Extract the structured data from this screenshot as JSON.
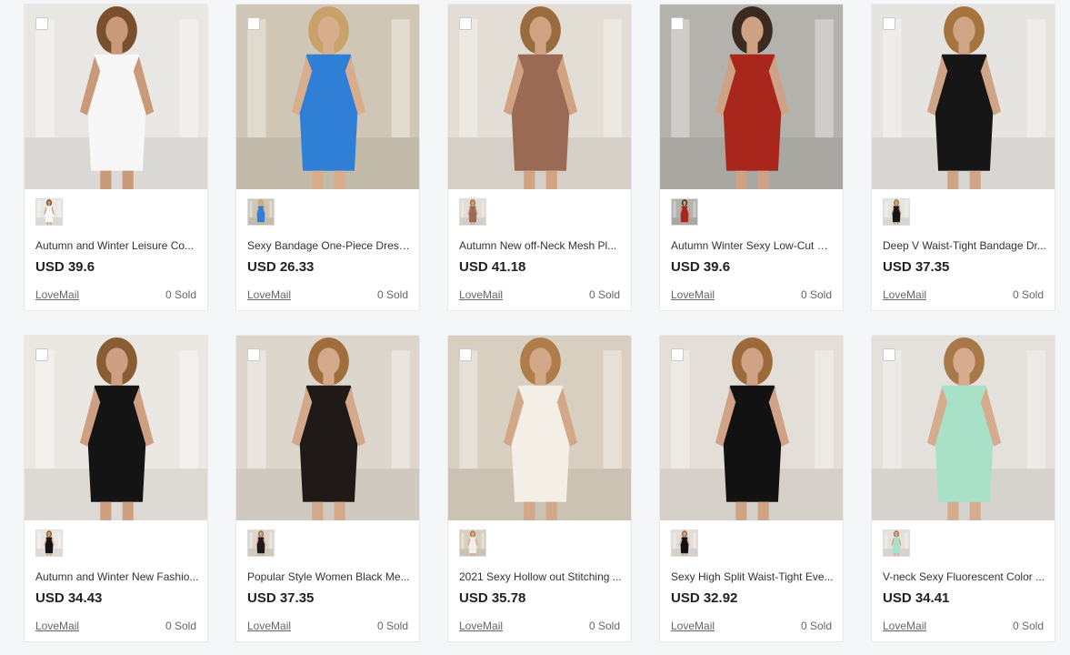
{
  "products": [
    {
      "title": "Autumn and Winter Leisure Co...",
      "price": "USD 39.6",
      "shop": "LoveMail",
      "sold": "0 Sold",
      "bg": "#e9e7e3",
      "dress": "#f7f7f7",
      "skin": "#c99a7a",
      "hair": "#7a4f2e"
    },
    {
      "title": "Sexy Bandage One-Piece Dress ...",
      "price": "USD 26.33",
      "shop": "LoveMail",
      "sold": "0 Sold",
      "bg": "#cfc6b6",
      "dress": "#2f7fd6",
      "skin": "#d8ad8c",
      "hair": "#c8a26a"
    },
    {
      "title": "Autumn New off-Neck Mesh Pl...",
      "price": "USD 41.18",
      "shop": "LoveMail",
      "sold": "0 Sold",
      "bg": "#e2ddd5",
      "dress": "#9a6a55",
      "skin": "#d2a383",
      "hair": "#9a6b3e"
    },
    {
      "title": "Autumn Winter Sexy Low-Cut Sl...",
      "price": "USD 39.6",
      "shop": "LoveMail",
      "sold": "0 Sold",
      "bg": "#b4b2ad",
      "dress": "#a8261c",
      "skin": "#cfa285",
      "hair": "#3a2a20"
    },
    {
      "title": "Deep V Waist-Tight Bandage Dr...",
      "price": "USD 37.35",
      "shop": "LoveMail",
      "sold": "0 Sold",
      "bg": "#e6e4e0",
      "dress": "#161616",
      "skin": "#d0a487",
      "hair": "#a5743f"
    },
    {
      "title": "Autumn and Winter New Fashio...",
      "price": "USD 34.43",
      "shop": "LoveMail",
      "sold": "0 Sold",
      "bg": "#ebe7e2",
      "dress": "#141414",
      "skin": "#cf9f82",
      "hair": "#8a5c34"
    },
    {
      "title": "Popular Style Women Black Me...",
      "price": "USD 37.35",
      "shop": "LoveMail",
      "sold": "0 Sold",
      "bg": "#ddd6cc",
      "dress": "#1f1a17",
      "skin": "#d4a88b",
      "hair": "#a06e3c"
    },
    {
      "title": "2021 Sexy Hollow out Stitching ...",
      "price": "USD 35.78",
      "shop": "LoveMail",
      "sold": "0 Sold",
      "bg": "#d9cfc0",
      "dress": "#f3efe6",
      "skin": "#d2a888",
      "hair": "#b07d48"
    },
    {
      "title": "Sexy High Split Waist-Tight Eve...",
      "price": "USD 32.92",
      "shop": "LoveMail",
      "sold": "0 Sold",
      "bg": "#e3ded7",
      "dress": "#121212",
      "skin": "#d0a386",
      "hair": "#9c6a3a"
    },
    {
      "title": "V-neck Sexy Fluorescent Color ...",
      "price": "USD 34.41",
      "shop": "LoveMail",
      "sold": "0 Sold",
      "bg": "#e4e1dc",
      "dress": "#a9e0c8",
      "skin": "#d6ac8f",
      "hair": "#a87848"
    }
  ]
}
